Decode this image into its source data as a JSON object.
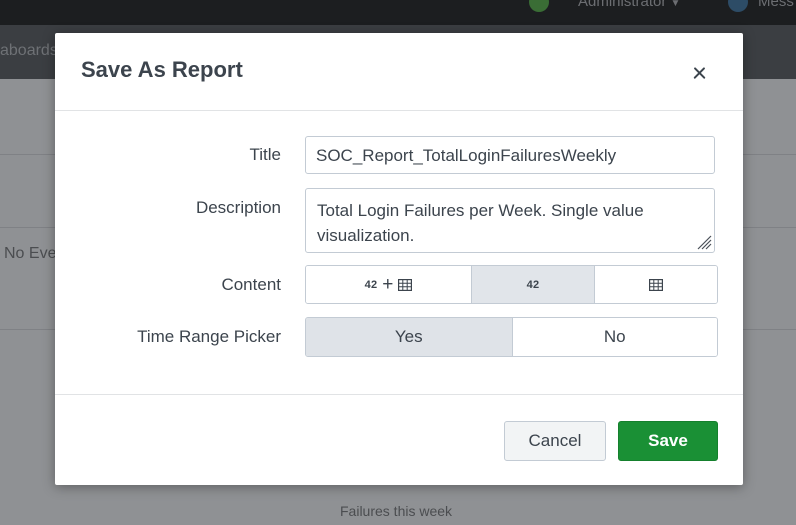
{
  "background": {
    "topbar": {
      "admin_label": "Administrator",
      "messages_label": "Mess"
    },
    "nav": {
      "dashboards_label": "aboards"
    },
    "content": {
      "no_events_text": "No Eve",
      "panel_caption": "Failures this week"
    }
  },
  "modal": {
    "title": "Save As Report",
    "fields": {
      "title_label": "Title",
      "title_value": "SOC_Report_TotalLoginFailuresWeekly",
      "description_label": "Description",
      "description_value": "Total Login Failures per Week. Single value visualization.",
      "content_label": "Content",
      "content_options": [
        {
          "number": "42",
          "has_plus": true,
          "icon": "table-icon",
          "active": false
        },
        {
          "number": "42",
          "active": true
        },
        {
          "icon": "table-icon",
          "active": false
        }
      ],
      "time_range_label": "Time Range Picker",
      "time_range_options": [
        {
          "label": "Yes",
          "active": true
        },
        {
          "label": "No",
          "active": false
        }
      ]
    },
    "buttons": {
      "cancel_label": "Cancel",
      "save_label": "Save"
    }
  },
  "colors": {
    "save_button": "#1a9035",
    "text_primary": "#3c444d",
    "active_segment": "#e1e5ea"
  }
}
